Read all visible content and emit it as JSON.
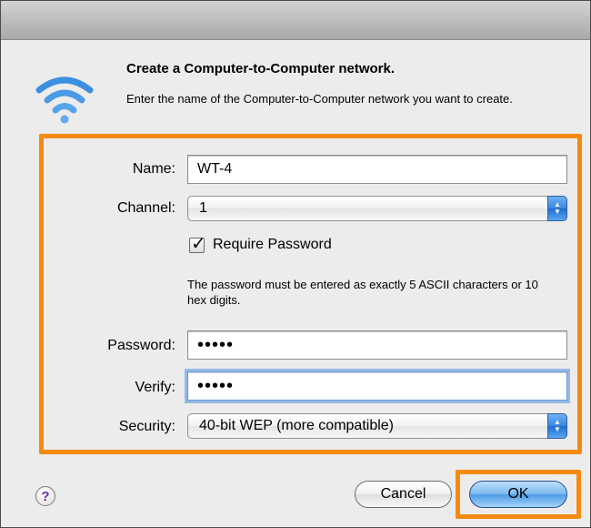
{
  "dialog": {
    "heading": "Create a Computer-to-Computer network.",
    "description": "Enter the name of the Computer-to-Computer network you want to create."
  },
  "form": {
    "name_label": "Name:",
    "name_value": "WT-4",
    "channel_label": "Channel:",
    "channel_value": "1",
    "require_password_label": "Require Password",
    "require_password_checked": true,
    "password_hint": "The password must be entered as exactly 5 ASCII characters or 10 hex digits.",
    "password_label": "Password:",
    "password_masked": "•••••",
    "verify_label": "Verify:",
    "verify_masked": "•••••",
    "security_label": "Security:",
    "security_value": "40-bit WEP (more compatible)"
  },
  "buttons": {
    "help": "?",
    "cancel": "Cancel",
    "ok": "OK"
  },
  "colors": {
    "highlight_box": "#f58a11",
    "wifi_icon": "#3d8fe0",
    "default_button": "#4d9be6"
  },
  "icons": {
    "network": "wifi-icon",
    "popup_arrows": "up-down-arrows-icon",
    "checkbox": "checkmark-icon",
    "help": "question-mark-icon"
  }
}
